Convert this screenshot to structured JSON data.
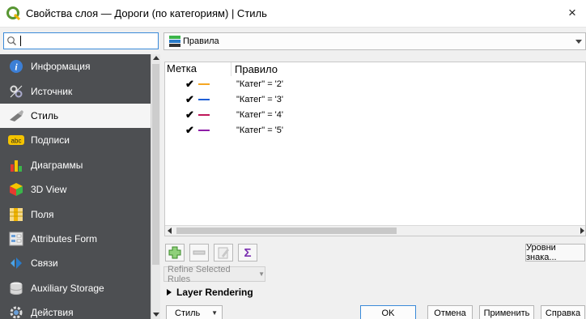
{
  "window": {
    "title": "Свойства слоя — Дороги (по категориям) | Стиль",
    "close_label": "×"
  },
  "sidebar": {
    "search": {
      "value": "",
      "placeholder": ""
    },
    "items": [
      {
        "label": "Информация",
        "icon": "info-icon",
        "selected": false
      },
      {
        "label": "Источник",
        "icon": "source-icon",
        "selected": false
      },
      {
        "label": "Стиль",
        "icon": "paintbrush-icon",
        "selected": true
      },
      {
        "label": "Подписи",
        "icon": "labels-abc-icon",
        "selected": false
      },
      {
        "label": "Диаграммы",
        "icon": "diagrams-icon",
        "selected": false
      },
      {
        "label": "3D View",
        "icon": "cube-3d-icon",
        "selected": false
      },
      {
        "label": "Поля",
        "icon": "fields-icon",
        "selected": false
      },
      {
        "label": "Attributes Form",
        "icon": "form-icon",
        "selected": false
      },
      {
        "label": "Связи",
        "icon": "joins-icon",
        "selected": false
      },
      {
        "label": "Auxiliary Storage",
        "icon": "database-icon",
        "selected": false
      },
      {
        "label": "Действия",
        "icon": "actions-gear-icon",
        "selected": false
      }
    ]
  },
  "renderer": {
    "selected": "Правила",
    "icon": "rules-renderer-icon"
  },
  "rules_table": {
    "headers": {
      "label": "Метка",
      "rule": "Правило"
    },
    "rows": [
      {
        "checked": true,
        "check_glyph": "✔",
        "color": "#f5a623",
        "rule": "\"Катег\"  =  '2'"
      },
      {
        "checked": true,
        "check_glyph": "✔",
        "color": "#1e5fd6",
        "rule": "\"Катег\"  =  '3'"
      },
      {
        "checked": true,
        "check_glyph": "✔",
        "color": "#c0185a",
        "rule": "\"Катег\"  =  '4'"
      },
      {
        "checked": true,
        "check_glyph": "✔",
        "color": "#8e1ea8",
        "rule": "\"Катег\"  =  '5'"
      }
    ]
  },
  "toolbar": {
    "add_rule_icon": "add-rule-icon",
    "remove_rule_icon": "remove-rule-icon",
    "edit_rule_icon": "edit-rule-icon",
    "sigma_label": "Σ",
    "symbol_levels_label": "Уровни знака..."
  },
  "refine_label": "Refine Selected Rules",
  "layer_rendering_label": "Layer Rendering",
  "footer": {
    "style_label": "Стиль",
    "ok_label": "OK",
    "cancel_label": "Отмена",
    "apply_label": "Применить",
    "help_label": "Справка"
  }
}
